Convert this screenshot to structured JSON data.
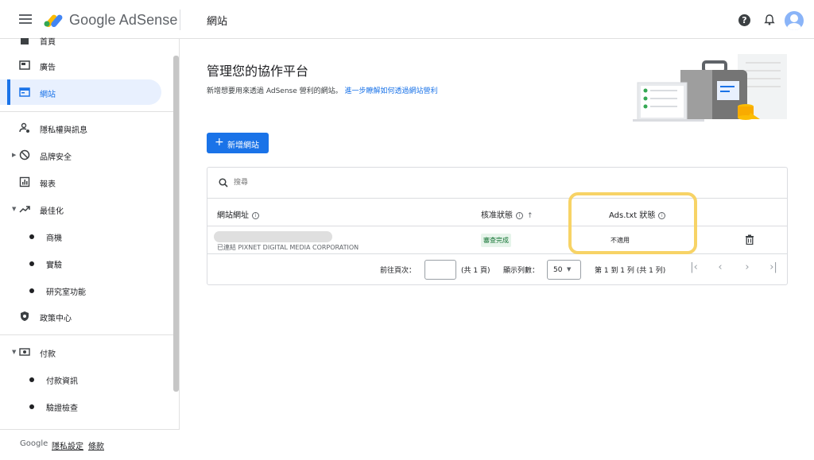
{
  "header": {
    "brand": "Google AdSense",
    "page": "網站"
  },
  "sidebar": {
    "items": [
      {
        "label": "首頁"
      },
      {
        "label": "廣告"
      },
      {
        "label": "網站"
      },
      {
        "label": "隱私權與訊息"
      },
      {
        "label": "品牌安全"
      },
      {
        "label": "報表"
      },
      {
        "label": "最佳化"
      },
      {
        "label": "商機"
      },
      {
        "label": "實驗"
      },
      {
        "label": "研究室功能"
      },
      {
        "label": "政策中心"
      },
      {
        "label": "付款"
      },
      {
        "label": "付款資訊"
      },
      {
        "label": "驗證檢查"
      }
    ],
    "active": "網站",
    "footer": {
      "google": "Google",
      "privacy": "隱私設定",
      "terms": "條款"
    }
  },
  "main": {
    "title": "管理您的協作平台",
    "subtitle": "新增想要用來透過 AdSense 營利的網站。",
    "learn_more": "進一步瞭解如何透過網站營利",
    "add_button": "新增網站",
    "search_placeholder": "搜尋",
    "table": {
      "columns": [
        "網站網址",
        "核准狀態",
        "Ads.txt 狀態"
      ],
      "rows": [
        {
          "site": "",
          "connected": "已連結 PIXNET DIGITAL MEDIA CORPORATION",
          "approval": "審查完成",
          "ads_txt": "不適用"
        }
      ]
    },
    "pagination": {
      "goto_label": "前往頁次：",
      "total_pages": "(共 1 頁)",
      "rows_label": "顯示列數：",
      "rows_value": "50",
      "range": "第 1 到 1 列 (共 1 列)"
    }
  },
  "colors": {
    "accent": "#1a73e8",
    "highlight": "#f7d366",
    "success": "#137333"
  }
}
